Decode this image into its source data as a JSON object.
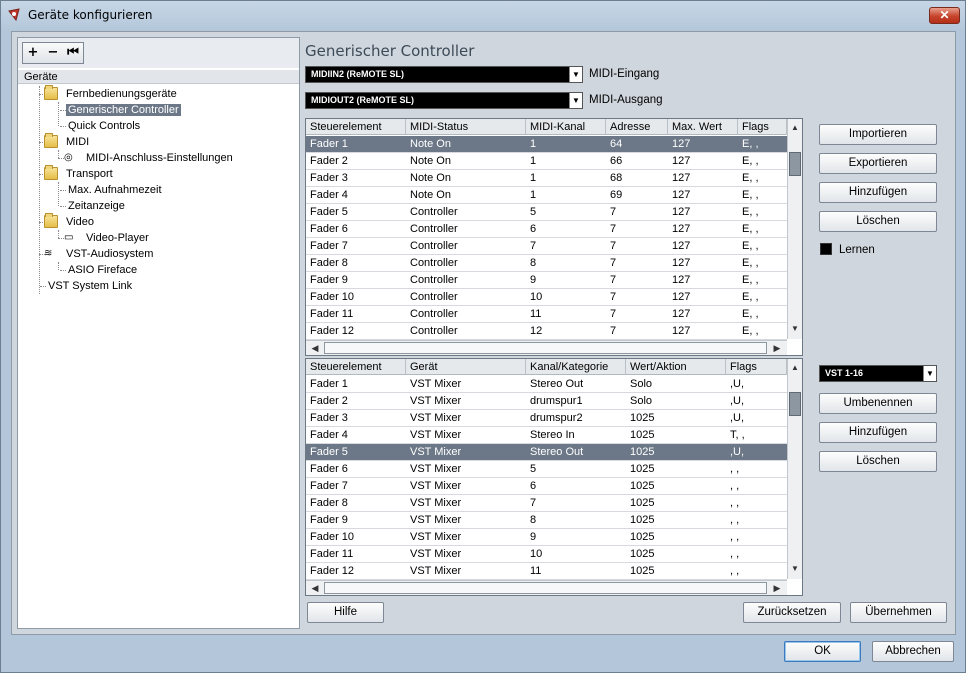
{
  "window": {
    "title": "Geräte konfigurieren",
    "close_label": "✕"
  },
  "left": {
    "toolbar": [
      "+",
      "−",
      "⏮"
    ],
    "tree_header": "Geräte",
    "items": [
      {
        "label": "Fernbedienungsgeräte",
        "icon": "folder-icon"
      },
      {
        "label": "Generischer Controller",
        "selected": true
      },
      {
        "label": "Quick Controls"
      },
      {
        "label": "MIDI",
        "icon": "folder-icon"
      },
      {
        "label": "MIDI-Anschluss-Einstellungen",
        "icon": "midi-port-icon"
      },
      {
        "label": "Transport",
        "icon": "folder-icon"
      },
      {
        "label": "Max. Aufnahmezeit"
      },
      {
        "label": "Zeitanzeige"
      },
      {
        "label": "Video",
        "icon": "folder-icon"
      },
      {
        "label": "Video-Player",
        "icon": "video-player-icon"
      },
      {
        "label": "VST-Audiosystem",
        "icon": "audio-system-icon"
      },
      {
        "label": "ASIO Fireface"
      },
      {
        "label": "VST System Link"
      }
    ]
  },
  "main": {
    "title": "Generischer Controller",
    "midi_in": {
      "value": "MIDIIN2 (ReMOTE SL)",
      "label": "MIDI-Eingang"
    },
    "midi_out": {
      "value": "MIDIOUT2 (ReMOTE SL)",
      "label": "MIDI-Ausgang"
    },
    "top_table": {
      "columns": [
        "Steuerelement",
        "MIDI-Status",
        "MIDI-Kanal",
        "Adresse",
        "Max. Wert",
        "Flags"
      ],
      "rows": [
        [
          "Fader 1",
          "Note On",
          "1",
          "64",
          "127",
          "E, ,"
        ],
        [
          "Fader 2",
          "Note On",
          "1",
          "66",
          "127",
          "E, ,"
        ],
        [
          "Fader 3",
          "Note On",
          "1",
          "68",
          "127",
          "E, ,"
        ],
        [
          "Fader 4",
          "Note On",
          "1",
          "69",
          "127",
          "E, ,"
        ],
        [
          "Fader 5",
          "Controller",
          "5",
          "7",
          "127",
          "E, ,"
        ],
        [
          "Fader 6",
          "Controller",
          "6",
          "7",
          "127",
          "E, ,"
        ],
        [
          "Fader 7",
          "Controller",
          "7",
          "7",
          "127",
          "E, ,"
        ],
        [
          "Fader 8",
          "Controller",
          "8",
          "7",
          "127",
          "E, ,"
        ],
        [
          "Fader 9",
          "Controller",
          "9",
          "7",
          "127",
          "E, ,"
        ],
        [
          "Fader 10",
          "Controller",
          "10",
          "7",
          "127",
          "E, ,"
        ],
        [
          "Fader 11",
          "Controller",
          "11",
          "7",
          "127",
          "E, ,"
        ],
        [
          "Fader 12",
          "Controller",
          "12",
          "7",
          "127",
          "E, ,"
        ]
      ],
      "selected_row": 0
    },
    "bottom_table": {
      "columns": [
        "Steuerelement",
        "Gerät",
        "Kanal/Kategorie",
        "Wert/Aktion",
        "Flags"
      ],
      "rows": [
        [
          "Fader 1",
          "VST Mixer",
          "Stereo Out",
          "Solo",
          ",U,"
        ],
        [
          "Fader 2",
          "VST Mixer",
          "drumspur1",
          "Solo",
          ",U,"
        ],
        [
          "Fader 3",
          "VST Mixer",
          "drumspur2",
          "1025",
          ",U,"
        ],
        [
          "Fader 4",
          "VST Mixer",
          "Stereo In",
          "1025",
          "T, ,"
        ],
        [
          "Fader 5",
          "VST Mixer",
          "Stereo Out",
          "1025",
          ",U,"
        ],
        [
          "Fader 6",
          "VST Mixer",
          "5",
          "1025",
          ", ,"
        ],
        [
          "Fader 7",
          "VST Mixer",
          "6",
          "1025",
          ", ,"
        ],
        [
          "Fader 8",
          "VST Mixer",
          "7",
          "1025",
          ", ,"
        ],
        [
          "Fader 9",
          "VST Mixer",
          "8",
          "1025",
          ", ,"
        ],
        [
          "Fader 10",
          "VST Mixer",
          "9",
          "1025",
          ", ,"
        ],
        [
          "Fader 11",
          "VST Mixer",
          "10",
          "1025",
          ", ,"
        ],
        [
          "Fader 12",
          "VST Mixer",
          "11",
          "1025",
          ", ,"
        ]
      ],
      "selected_row": 4
    },
    "top_buttons": [
      "Importieren",
      "Exportieren",
      "Hinzufügen",
      "Löschen"
    ],
    "learn_label": "Lernen",
    "bank": {
      "value": "VST 1-16"
    },
    "bottom_buttons": [
      "Umbenennen",
      "Hinzufügen",
      "Löschen"
    ],
    "help_label": "Hilfe",
    "reset_label": "Zurücksetzen",
    "apply_label": "Übernehmen"
  },
  "footer": {
    "ok_label": "OK",
    "cancel_label": "Abbrechen"
  },
  "colors": {
    "selection": "#6c7887",
    "combo_bg": "#000000",
    "title_accent": "#3c4a58"
  }
}
